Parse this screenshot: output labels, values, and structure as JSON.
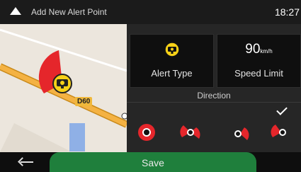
{
  "header": {
    "title": "Add New Alert Point",
    "time": "18:27"
  },
  "map": {
    "road_label": "D60"
  },
  "panel": {
    "alert_type_label": "Alert Type",
    "speed_value": "90",
    "speed_unit": "km/h",
    "speed_label": "Speed Limit",
    "direction_label": "Direction",
    "direction_options": [
      "omnidirectional",
      "forward",
      "backward",
      "both-directions"
    ],
    "selected_direction": "both-directions"
  },
  "footer": {
    "save_label": "Save"
  },
  "colors": {
    "save_green": "#1f7f3c",
    "alert_red": "#e5262b",
    "road_orange": "#f0a030"
  }
}
